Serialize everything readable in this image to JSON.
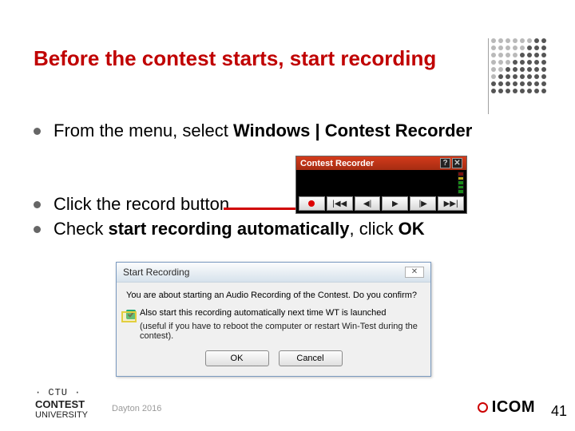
{
  "title": "Before the contest starts, start recording",
  "bullets": {
    "b1_pre": "From the menu, select ",
    "b1_bold": "Windows | Contest Recorder",
    "b2": "Click the record button",
    "b3_pre": "Check ",
    "b3_bold": "start recording automatically",
    "b3_post": ", click ",
    "b3_ok": "OK"
  },
  "recorder": {
    "title": "Contest Recorder",
    "help": "?",
    "close": "✕",
    "btn_prev_all": "|◀◀",
    "btn_prev": "◀|",
    "btn_play": "▶",
    "btn_next": "|▶",
    "btn_next_all": "▶▶|"
  },
  "dialog": {
    "title": "Start Recording",
    "close": "✕",
    "message": "You are about starting an Audio Recording of the Contest. Do you confirm?",
    "checkbox_label": "Also start this recording automatically next time WT is launched",
    "hint": "(useful if you have to reboot the computer or restart Win-Test during the contest).",
    "ok": "OK",
    "cancel": "Cancel"
  },
  "footer": {
    "ctu_line": "· CTU ·",
    "contest": "CONTEST",
    "university": "UNIVERSITY",
    "date": "Dayton 2016",
    "brand": "ICOM",
    "page": "41"
  }
}
